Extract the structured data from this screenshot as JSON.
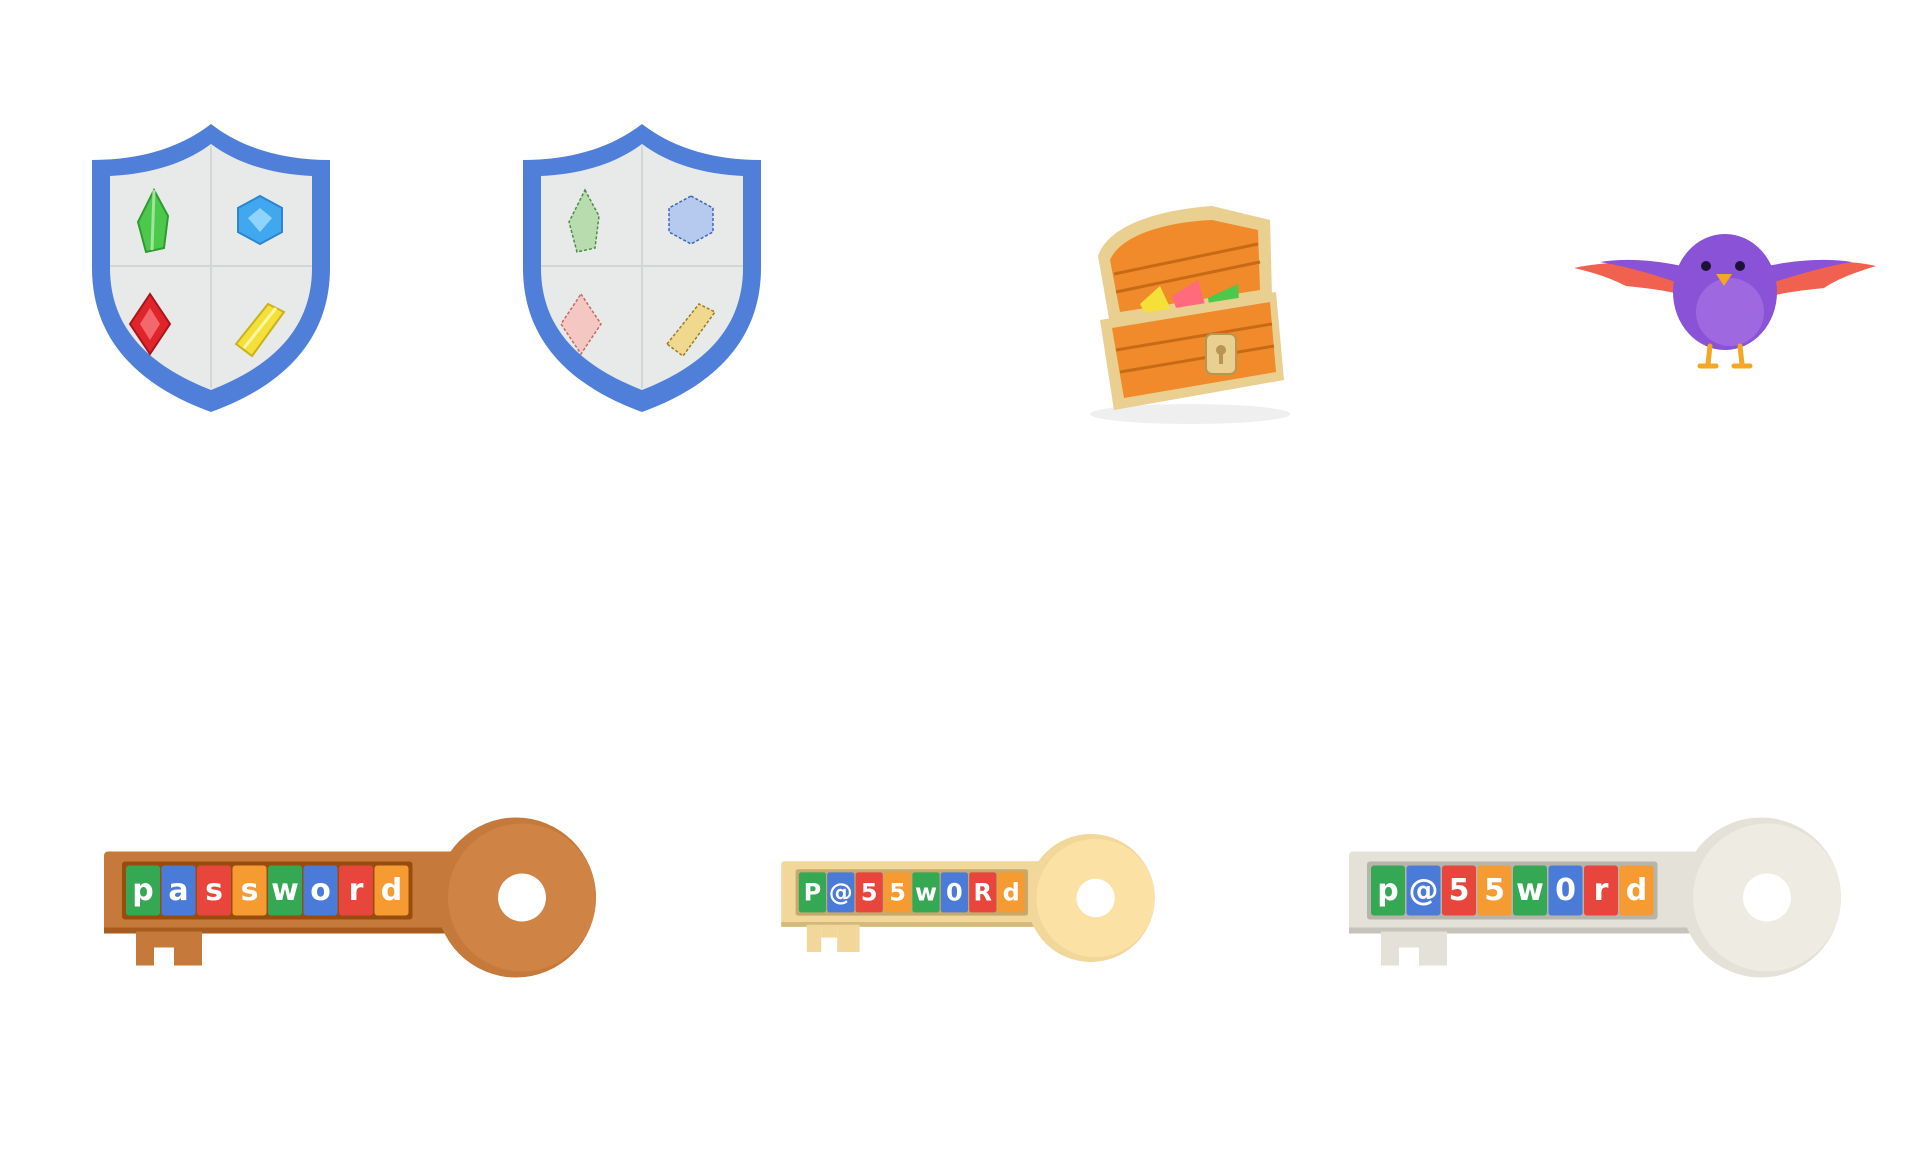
{
  "assets": {
    "shield_filled": {
      "icon": "shield-gems-icon"
    },
    "shield_outline": {
      "icon": "shield-outline-gems-icon"
    },
    "treasure_chest": {
      "icon": "treasure-chest-icon"
    },
    "bird": {
      "icon": "purple-bird-icon"
    }
  },
  "keys": [
    {
      "label": [
        "p",
        "a",
        "s",
        "s",
        "w",
        "o",
        "r",
        "d"
      ],
      "color": "#c57a3c"
    },
    {
      "label": [
        "P",
        "@",
        "5",
        "5",
        "w",
        "0",
        "R",
        "d"
      ],
      "color": "#f2d79a"
    },
    {
      "label": [
        "p",
        "@",
        "5",
        "5",
        "w",
        "0",
        "r",
        "d"
      ],
      "color": "#e4e1d8"
    }
  ],
  "tile_colors": [
    "#34a853",
    "#4a7bd8",
    "#e8453c",
    "#f59b31",
    "#34a853",
    "#4a7bd8",
    "#e8453c",
    "#f59b31"
  ],
  "colors": {
    "shield_border": "#4f7fd9",
    "shield_face": "#e8eaea",
    "gem_green": "#4cc94a",
    "gem_blue": "#41a8f0",
    "gem_red": "#e0242b",
    "gem_yellow": "#f5e03a",
    "bird_body": "#8a52d6",
    "bird_wing": "#f0624f",
    "chest_orange": "#f08a2a",
    "chest_gold": "#e9cf90"
  }
}
